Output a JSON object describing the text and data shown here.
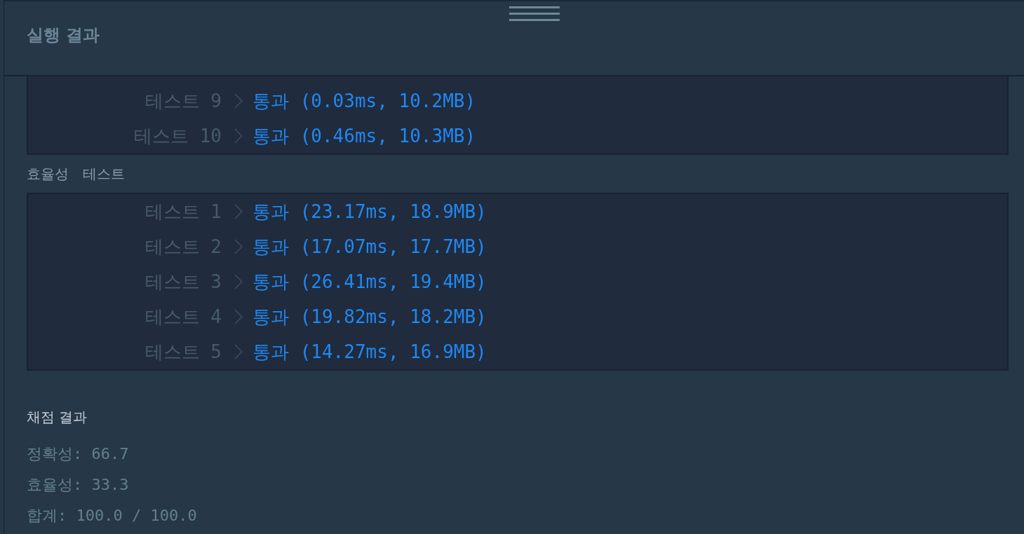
{
  "panel": {
    "title": "실행 결과"
  },
  "accuracy_results": [
    {
      "label": "테스트 9",
      "result": "통과 (0.03ms, 10.2MB)"
    },
    {
      "label": "테스트 10",
      "result": "통과 (0.46ms, 10.3MB)"
    }
  ],
  "efficiency_section": {
    "title": "효율성 테스트",
    "results": [
      {
        "label": "테스트 1",
        "result": "통과 (23.17ms, 18.9MB)"
      },
      {
        "label": "테스트 2",
        "result": "통과 (17.07ms, 17.7MB)"
      },
      {
        "label": "테스트 3",
        "result": "통과 (26.41ms, 19.4MB)"
      },
      {
        "label": "테스트 4",
        "result": "통과 (19.82ms, 18.2MB)"
      },
      {
        "label": "테스트 5",
        "result": "통과 (14.27ms, 16.9MB)"
      }
    ]
  },
  "grading": {
    "title": "채점 결과",
    "lines": [
      "정확성: 66.7",
      "효율성: 33.3",
      "합계: 100.0 / 100.0"
    ]
  }
}
